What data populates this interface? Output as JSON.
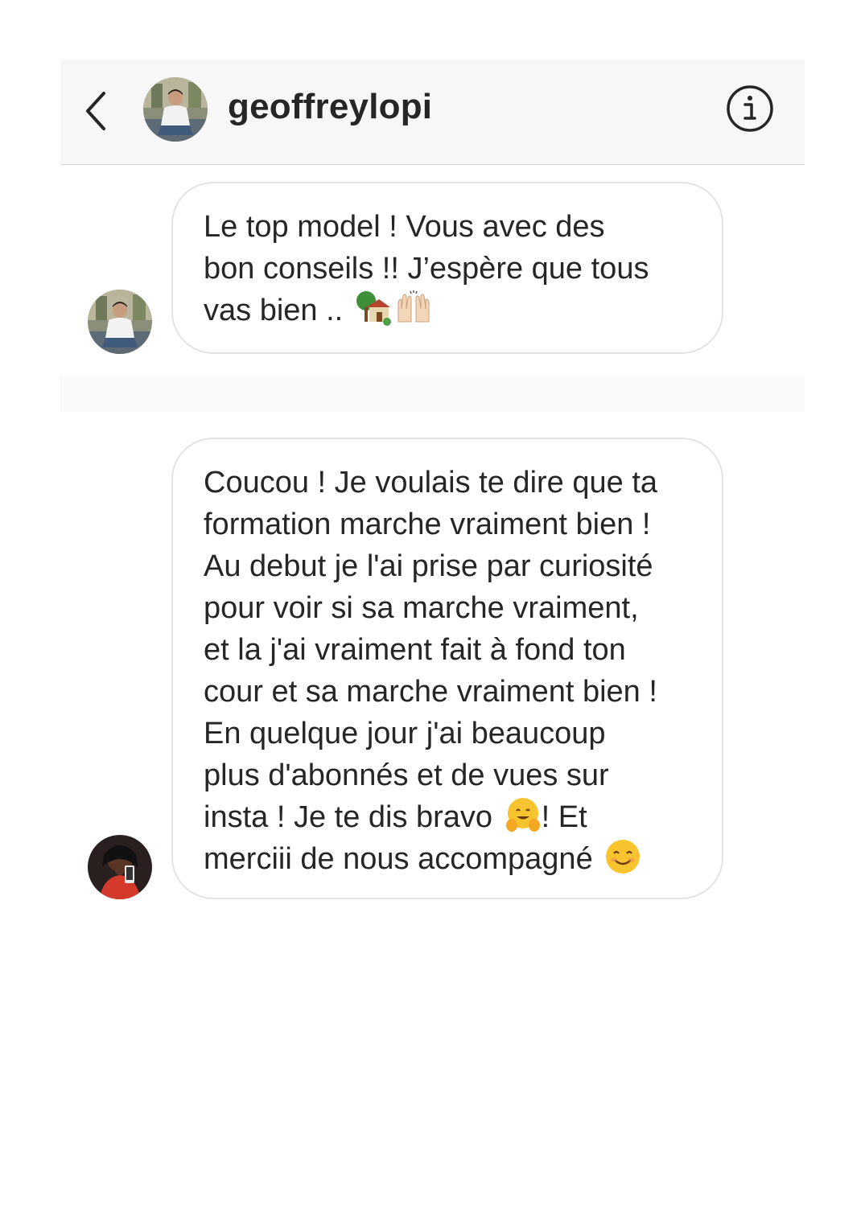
{
  "header": {
    "username": "geoffreylopi",
    "back_icon": "chevron-left-icon",
    "info_icon": "info-circle-icon"
  },
  "messages": [
    {
      "sender": "geoffreylopi",
      "lines": [
        "Le top model ! Vous avec des",
        "bon conseils !!  J’espère que tous",
        "vas bien .."
      ],
      "emojis": [
        "house-with-garden",
        "raising-hands"
      ]
    },
    {
      "sender": "other",
      "lines": [
        "Coucou ! Je voulais te dire que ta",
        "formation marche vraiment bien !",
        "Au debut je l'ai prise par curiosité",
        "pour voir si sa marche vraiment,",
        "et la j'ai vraiment fait à fond ton",
        "cour et sa marche vraiment bien !",
        "En quelque jour j'ai beaucoup",
        "plus d'abonnés et de vues sur",
        "insta ! Je te dis bravo",
        "! Et",
        "merciii de nous accompagné"
      ],
      "emojis": [
        "hugging-face",
        "smiling-face"
      ]
    }
  ],
  "colors": {
    "header_bg": "#f7f7f7",
    "bubble_border": "#e3e3e3",
    "text": "#262626"
  }
}
